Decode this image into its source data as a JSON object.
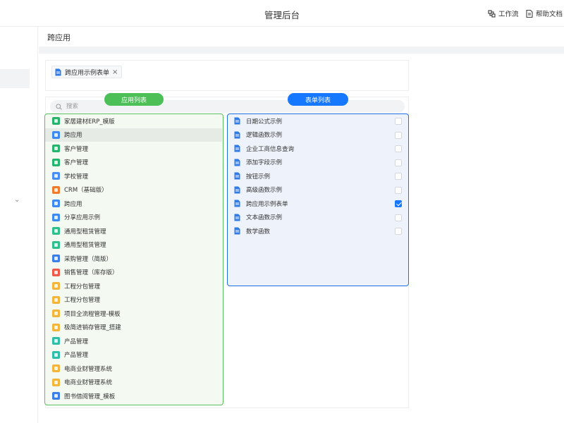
{
  "header": {
    "title": "管理后台",
    "workflow_label": "工作流",
    "help_label": "帮助文档"
  },
  "page": {
    "title": "跨应用"
  },
  "selected_tags": [
    {
      "label": "跨应用示例表单",
      "icon": "form-doc-icon"
    }
  ],
  "search": {
    "placeholder": "搜索",
    "value": ""
  },
  "app_list": {
    "label": "应用列表",
    "accent": "#4cbf57",
    "selected_index": 1,
    "items": [
      {
        "label": "家居建材ERP_模版",
        "icon_color": "#27b36b"
      },
      {
        "label": "跨应用",
        "icon_color": "#3d8bf2"
      },
      {
        "label": "客户管理",
        "icon_color": "#26b46e"
      },
      {
        "label": "客户管理",
        "icon_color": "#26b46e"
      },
      {
        "label": "学校管理",
        "icon_color": "#4a8df5"
      },
      {
        "label": "CRM（基础版）",
        "icon_color": "#f07b2c"
      },
      {
        "label": "跨应用",
        "icon_color": "#3d8bf2"
      },
      {
        "label": "分享应用示例",
        "icon_color": "#3d8bf2"
      },
      {
        "label": "通用型租赁管理",
        "icon_color": "#2fbf8c"
      },
      {
        "label": "通用型租赁管理",
        "icon_color": "#2fbf8c"
      },
      {
        "label": "采购管理（简版）",
        "icon_color": "#3d7fe6"
      },
      {
        "label": "销售管理（库存版）",
        "icon_color": "#ee5a4a"
      },
      {
        "label": "工程分包管理",
        "icon_color": "#f3b53c"
      },
      {
        "label": "工程分包管理",
        "icon_color": "#f3b53c"
      },
      {
        "label": "项目全流程管理-模板",
        "icon_color": "#f3b53c"
      },
      {
        "label": "极简进销存管理_搭建",
        "icon_color": "#f3b53c"
      },
      {
        "label": "产品管理",
        "icon_color": "#2fbfa8"
      },
      {
        "label": "产品管理",
        "icon_color": "#2fbfa8"
      },
      {
        "label": "电商业财管理系统",
        "icon_color": "#f3b53c"
      },
      {
        "label": "电商业财管理系统",
        "icon_color": "#f3b53c"
      },
      {
        "label": "图书借阅管理_模板",
        "icon_color": "#3d7fe6"
      }
    ]
  },
  "form_list": {
    "label": "表单列表",
    "accent": "#1677ff",
    "items": [
      {
        "label": "日期公式示例",
        "checked": false
      },
      {
        "label": "逻辑函数示例",
        "checked": false
      },
      {
        "label": "企业工商信息查询",
        "checked": false
      },
      {
        "label": "添加字段示例",
        "checked": false
      },
      {
        "label": "按钮示例",
        "checked": false
      },
      {
        "label": "高级函数示例",
        "checked": false
      },
      {
        "label": "跨应用示例表单",
        "checked": true
      },
      {
        "label": "文本函数示例",
        "checked": false
      },
      {
        "label": "数学函数",
        "checked": false
      }
    ]
  }
}
